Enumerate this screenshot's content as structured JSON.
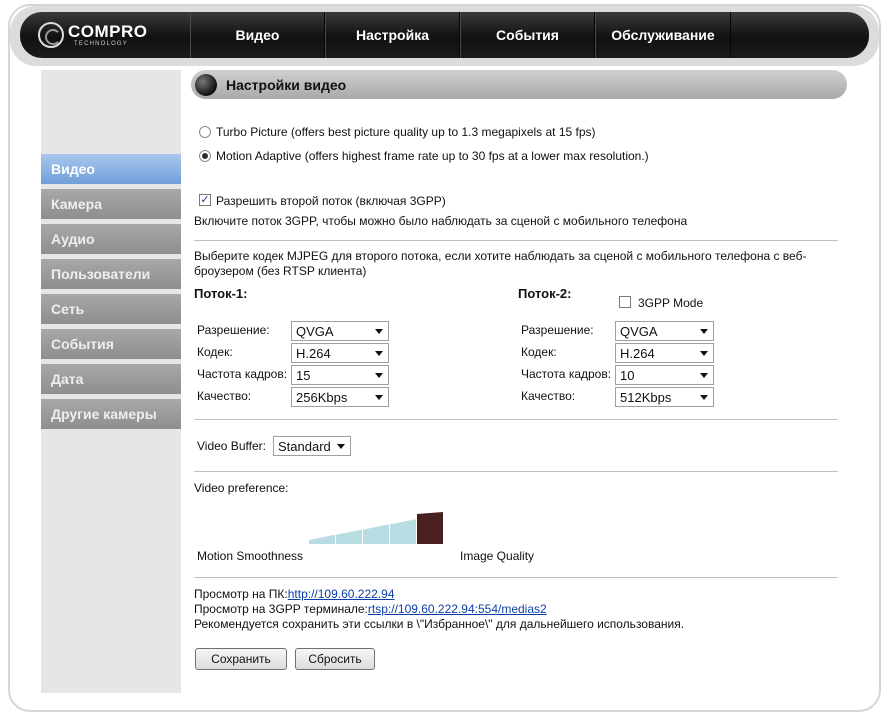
{
  "header": {
    "logo_main": "COMPRO",
    "logo_sub": "TECHNOLOGY",
    "nav": [
      "Видео",
      "Настройка",
      "События",
      "Обслуживание"
    ]
  },
  "sidebar": {
    "items": [
      "Видео",
      "Камера",
      "Аудио",
      "Пользователи",
      "Сеть",
      "События",
      "Дата",
      "Другие камеры"
    ],
    "active_index": 0
  },
  "page": {
    "title": "Настройки видео",
    "mode_options": [
      {
        "label": "Turbo Picture (offers best picture quality up to 1.3 megapixels at 15 fps)",
        "checked": false
      },
      {
        "label": "Motion Adaptive (offers highest frame rate up to 30 fps at a lower max resolution.)",
        "checked": true
      }
    ],
    "second_stream": {
      "label": "Разрешить второй поток (включая 3GPP)",
      "checked": true,
      "hint": "Включите поток 3GPP, чтобы можно было наблюдать за сценой с мобильного телефона"
    },
    "mjpeg_hint_line1": "Выберите кодек MJPEG для второго потока, если хотите наблюдать за сценой с мобильного телефона с веб-",
    "mjpeg_hint_line2": "броузером (без RTSP клиента)",
    "stream1": {
      "title": "Поток-1:",
      "labels": [
        "Разрешение:",
        "Кодек:",
        "Частота кадров:",
        "Качество:"
      ],
      "values": [
        "QVGA",
        "H.264",
        "15",
        "256Kbps"
      ]
    },
    "stream2": {
      "title": "Поток-2:",
      "gpp_mode_label": "3GPP Mode",
      "gpp_mode_checked": false,
      "labels": [
        "Разрешение:",
        "Кодек:",
        "Частота кадров:",
        "Качество:"
      ],
      "values": [
        "QVGA",
        "H.264",
        "10",
        "512Kbps"
      ]
    },
    "video_buffer": {
      "label": "Video Buffer:",
      "value": "Standard"
    },
    "preference": {
      "label": "Video preference:",
      "left_label": "Motion Smoothness",
      "right_label": "Image Quality",
      "level": 5,
      "levels": 5,
      "color_inactive": "#b7dde2",
      "color_active": "#4a1f1f"
    },
    "links": {
      "pc_prefix": "Просмотр на ПК:",
      "pc_url": "http://109.60.222.94",
      "gpp_prefix": "Просмотр на 3GPP терминале:",
      "gpp_url": "rtsp://109.60.222.94:554/medias2",
      "note": "Рекомендуется сохранить эти ссылки в \\\"Избранное\\\" для дальнейшего использования."
    },
    "buttons": {
      "save": "Сохранить",
      "reset": "Сбросить"
    }
  }
}
